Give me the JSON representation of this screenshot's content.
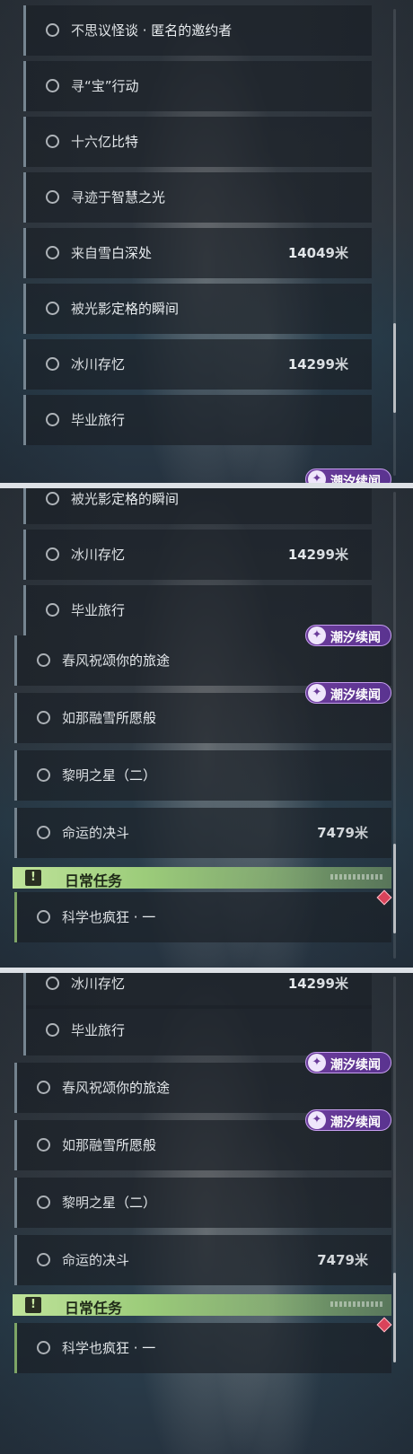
{
  "quests": {
    "anomalous_tales": {
      "title": "不思议怪谈 · 匿名的邀约者"
    },
    "treasure_op": {
      "title": "寻“宝”行动"
    },
    "sixteen_bits": {
      "title": "十六亿比特"
    },
    "wisdom_light": {
      "title": "寻迹于智慧之光"
    },
    "snow_depth": {
      "title": "来自雪白深处",
      "distance": "14049米"
    },
    "light_moment": {
      "title": "被光影定格的瞬间"
    },
    "glacier": {
      "title": "冰川存忆",
      "distance": "14299米"
    },
    "graduation": {
      "title": "毕业旅行"
    },
    "spring_wind": {
      "title": "春风祝颂你的旅途"
    },
    "snow_wish": {
      "title": "如那融雪所愿般"
    },
    "dawn_star": {
      "title": "黎明之星（二）"
    },
    "fate_duel": {
      "title": "命运的决斗",
      "distance": "7479米"
    },
    "science": {
      "title": "科学也疯狂 · 一"
    }
  },
  "badge": {
    "label": "潮汐续闻",
    "icon": "tide-icon"
  },
  "daily": {
    "title": "日常任务",
    "icon": "exclamation-icon",
    "accent": "#9ccc7a"
  },
  "colors": {
    "badge": "#6b3c9a",
    "diamond": "#d9435a",
    "quest_bg": "#1c2128"
  }
}
